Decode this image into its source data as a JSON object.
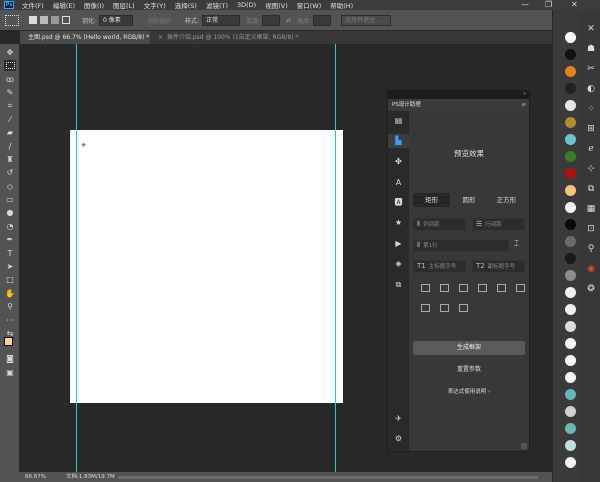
{
  "menubar": {
    "logo": "Ps",
    "items": [
      "文件(F)",
      "编辑(E)",
      "图像(I)",
      "图层(L)",
      "文字(Y)",
      "选择(S)",
      "滤镜(T)",
      "3D(D)",
      "视图(V)",
      "窗口(W)",
      "帮助(H)"
    ],
    "minimize": "—",
    "restore": "❐",
    "close": "✕"
  },
  "options": {
    "feather_label": "羽化:",
    "feather_value": "0 像素",
    "antialias": "消除锯齿",
    "style_label": "样式:",
    "style_value": "正常",
    "width_label": "宽度:",
    "height_label": "高度:",
    "select_mask": "选择并遮住..."
  },
  "tabs": [
    {
      "label": "主图.psd @ 66.7% (Hello world, RGB/8) *",
      "close": "×"
    },
    {
      "label": "插件介绍.psd @ 100% (1自定义框架, RGB/8) *",
      "close": "×"
    }
  ],
  "status": {
    "zoom": "66.67%",
    "doc": "文档:1.83M/19.7M"
  },
  "plugin": {
    "title": "PS设计助理",
    "preview": "预览效果",
    "shapes": [
      "矩形",
      "圆形",
      "正方形"
    ],
    "col_spacing": "列间距",
    "row_spacing": "行间距",
    "row_count": "第1行",
    "main_title": "主标题字号",
    "sub_title": "副标题字号",
    "t1": "T1",
    "t2": "T2",
    "generate": "生成框架",
    "reset": "重置参数",
    "help": "表达式使用说明  ›"
  },
  "colors": {
    "accent": "#31a8ff",
    "guide": "#38c4c4",
    "canvas_bg": "#282828",
    "document": "#ffffff"
  },
  "swatches": [
    "#ffffff",
    "#111111",
    "#e8801a",
    "#222222",
    "#e6e6e6",
    "#b28a28",
    "#6ac6c8",
    "#3a7a2a",
    "#b01010",
    "#f2c67a",
    "#f2f2f2",
    "#0a0a0a",
    "#6a6a6a",
    "#191919",
    "#8c8c8c",
    "#efefef",
    "#f0f0f0",
    "#dcdcdc",
    "#f4f4f4",
    "#ffffff",
    "#f7f7f7",
    "#66b8b8",
    "#d0d0d0",
    "#6ab8b0",
    "#bfe0e0",
    "#f8f8f8"
  ]
}
